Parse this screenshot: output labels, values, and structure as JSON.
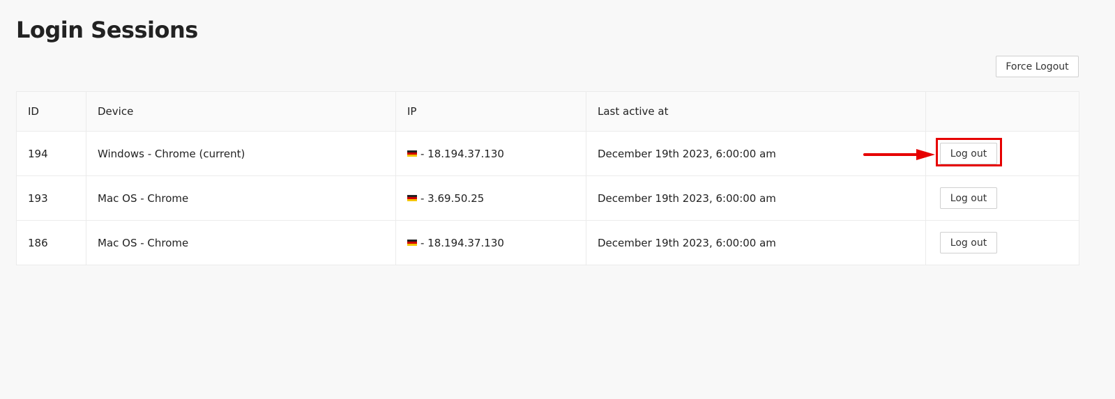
{
  "page": {
    "title": "Login Sessions"
  },
  "toolbar": {
    "force_logout_label": "Force Logout"
  },
  "table": {
    "headers": {
      "id": "ID",
      "device": "Device",
      "ip": "IP",
      "last_active": "Last active at",
      "action": ""
    },
    "rows": [
      {
        "id": "194",
        "device": "Windows - Chrome (current)",
        "flag_icon": "germany-flag-icon",
        "ip": "- 18.194.37.130",
        "last_active": "December 19th 2023, 6:00:00 am",
        "action_label": "Log out"
      },
      {
        "id": "193",
        "device": "Mac OS - Chrome",
        "flag_icon": "germany-flag-icon",
        "ip": "- 3.69.50.25",
        "last_active": "December 19th 2023, 6:00:00 am",
        "action_label": "Log out"
      },
      {
        "id": "186",
        "device": "Mac OS - Chrome",
        "flag_icon": "germany-flag-icon",
        "ip": "- 18.194.37.130",
        "last_active": "December 19th 2023, 6:00:00 am",
        "action_label": "Log out"
      }
    ]
  },
  "annotation": {
    "highlight_color": "#e60000",
    "arrow_icon": "red-arrow-icon",
    "highlight_target": "Log out"
  },
  "colors": {
    "background": "#f8f8f8",
    "table_background": "#ffffff",
    "border": "#ebebeb",
    "text": "#222222"
  }
}
